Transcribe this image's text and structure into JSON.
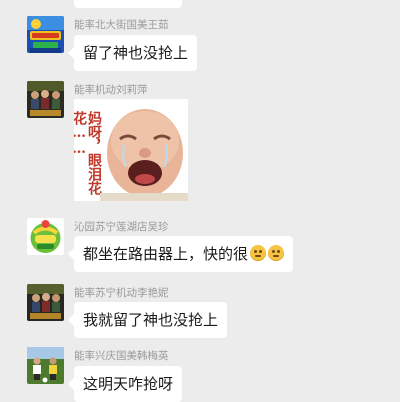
{
  "messages": [
    {
      "sender": "能率北大街国美王茹",
      "text": "留了神也没抢上",
      "avatar_icon": "game-logo-avatar-icon"
    },
    {
      "sender": "能率机动刘莉萍",
      "sticker_caption": "妈呀，眼泪花花……",
      "avatar_icon": "movie-poster-avatar-icon"
    },
    {
      "sender": "沁园苏宁莲湖店吴珍",
      "text": "都坐在路由器上，快的很",
      "emojis": [
        "dizzy-face-emoji-icon",
        "dizzy-face-emoji-icon"
      ],
      "avatar_icon": "cartoon-logo-avatar-icon"
    },
    {
      "sender": "能率苏宁机动李艳妮",
      "text": "我就留了神也没抢上",
      "avatar_icon": "movie-poster-avatar-icon"
    },
    {
      "sender": "能率兴庆国美韩梅英",
      "text": "这明天咋抢呀",
      "avatar_icon": "soccer-players-avatar-icon"
    }
  ],
  "colors": {
    "background": "#ececec",
    "bubble": "#ffffff",
    "sender_name": "#9a9a9a",
    "sticker_text": "#c0392b"
  }
}
